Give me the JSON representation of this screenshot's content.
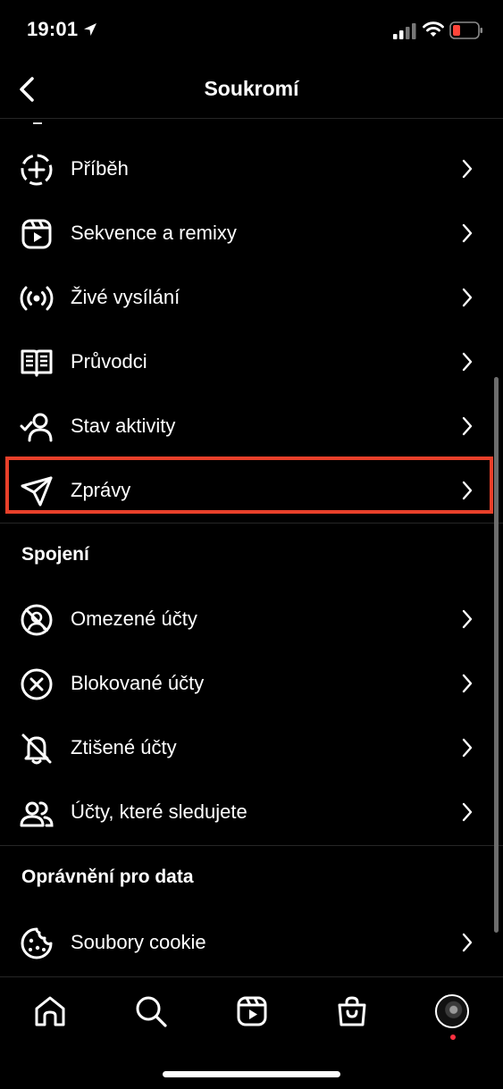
{
  "status_bar": {
    "time": "19:01",
    "battery_color": "#ff453a"
  },
  "nav": {
    "title": "Soukromí"
  },
  "rows_top": [
    {
      "label": "Příběh",
      "icon": "story-add-icon"
    },
    {
      "label": "Sekvence a remixy",
      "icon": "reels-icon"
    },
    {
      "label": "Živé vysílání",
      "icon": "live-broadcast-icon"
    },
    {
      "label": "Průvodci",
      "icon": "guides-book-icon"
    },
    {
      "label": "Stav aktivity",
      "icon": "activity-status-icon"
    },
    {
      "label": "Zprávy",
      "icon": "paper-plane-icon",
      "highlighted": true
    }
  ],
  "section_connections": {
    "title": "Spojení",
    "rows": [
      {
        "label": "Omezené účty",
        "icon": "restricted-icon"
      },
      {
        "label": "Blokované účty",
        "icon": "blocked-icon"
      },
      {
        "label": "Ztišené účty",
        "icon": "muted-bell-icon"
      },
      {
        "label": "Účty, které sledujete",
        "icon": "following-people-icon"
      }
    ]
  },
  "section_data": {
    "title": "Oprávnění pro data",
    "rows": [
      {
        "label": "Soubory cookie",
        "icon": "cookie-icon"
      }
    ]
  },
  "tabbar": {
    "items": [
      "home-icon",
      "search-icon",
      "reels-icon",
      "shop-icon",
      "profile-avatar"
    ]
  },
  "colors": {
    "highlight_border": "#e8402a",
    "notification_dot": "#ff3040"
  }
}
